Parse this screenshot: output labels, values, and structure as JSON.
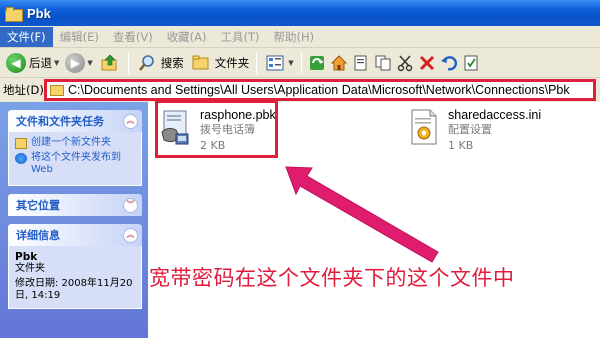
{
  "window": {
    "title": "Pbk"
  },
  "menu": [
    {
      "label": "文件(F)",
      "active": true
    },
    {
      "label": "编辑(E)"
    },
    {
      "label": "查看(V)"
    },
    {
      "label": "收藏(A)"
    },
    {
      "label": "工具(T)"
    },
    {
      "label": "帮助(H)"
    }
  ],
  "toolbar": {
    "back_label": "后退",
    "search_label": "搜索",
    "folders_label": "文件夹"
  },
  "address": {
    "label": "地址(D)",
    "path": "C:\\Documents and Settings\\All Users\\Application Data\\Microsoft\\Network\\Connections\\Pbk"
  },
  "left_pane": {
    "file_tasks": {
      "title": "文件和文件夹任务",
      "items": [
        {
          "label": "创建一个新文件夹",
          "icon": "new-folder-icon"
        },
        {
          "label": "将这个文件夹发布到 Web",
          "icon": "publish-web-icon"
        }
      ]
    },
    "other_places": {
      "title": "其它位置"
    },
    "details": {
      "title": "详细信息",
      "name": "Pbk",
      "type": "文件夹",
      "modified": "修改日期: 2008年11月20日, 14:19"
    }
  },
  "files": [
    {
      "name": "rasphone.pbk",
      "type": "拨号电话簿",
      "size": "2 KB",
      "icon": "phonebook-icon"
    },
    {
      "name": "sharedaccess.ini",
      "type": "配置设置",
      "size": "1 KB",
      "icon": "ini-settings-icon"
    }
  ],
  "annotation": {
    "text": "宽带密码在这个文件夹下的这个文件中",
    "color": "#e01c3c"
  },
  "colors": {
    "title_bar": "#0a52c9",
    "task_pane": "#6375d6",
    "highlight": "#e0203a"
  }
}
